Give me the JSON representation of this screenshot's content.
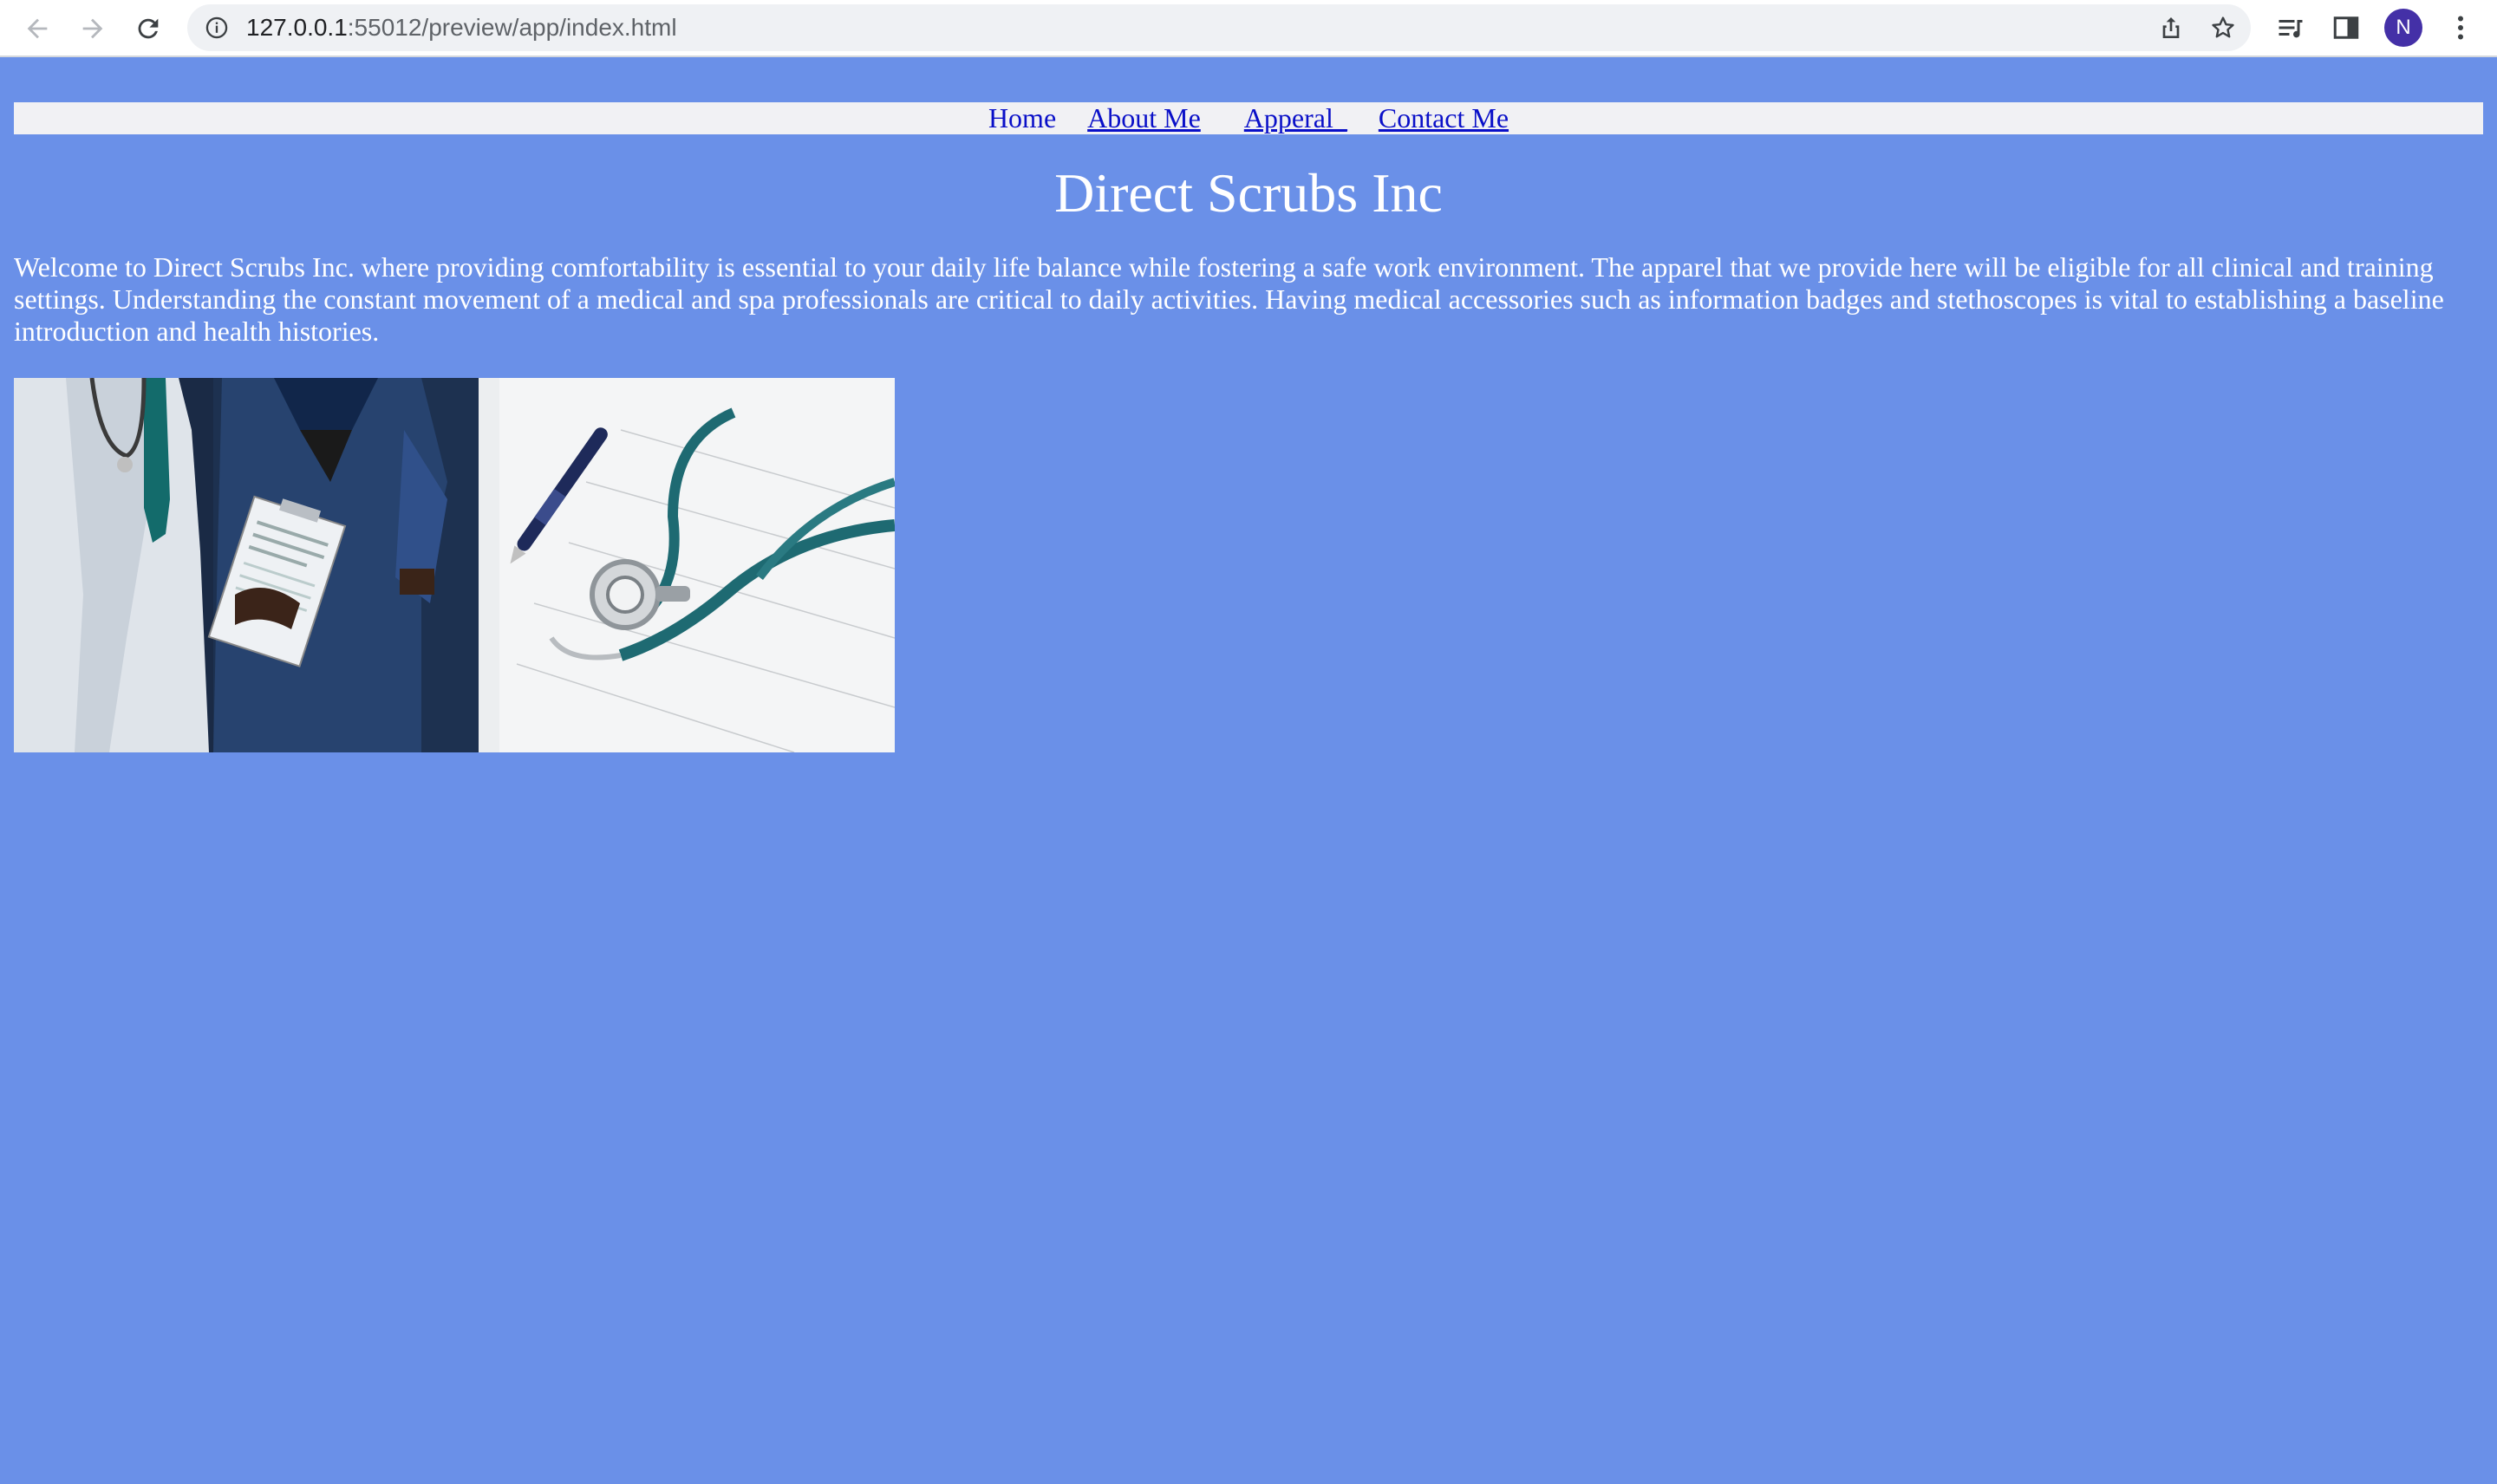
{
  "browser": {
    "url_host": "127.0.0.1",
    "url_rest": ":55012/preview/app/index.html",
    "profile_initial": "N"
  },
  "nav": {
    "home": "Home",
    "about": "About Me",
    "apparel": "Apperal_",
    "contact": "Contact Me"
  },
  "page": {
    "title": "Direct Scrubs Inc",
    "intro": "Welcome to Direct Scrubs Inc. where providing comfortability is essential to your daily life balance while fostering a safe work environment. The apparel that we provide here will be eligible for all clinical and training settings. Understanding the constant movement of a medical and spa professionals are critical to daily activities. Having medical accessories such as information badges and stethoscopes is vital to establishing a baseline introduction and health histories."
  },
  "colors": {
    "page_bg": "#6a90e8",
    "nav_bg": "#f1f1f4",
    "link": "#0a10c8",
    "text": "#ffffff"
  }
}
